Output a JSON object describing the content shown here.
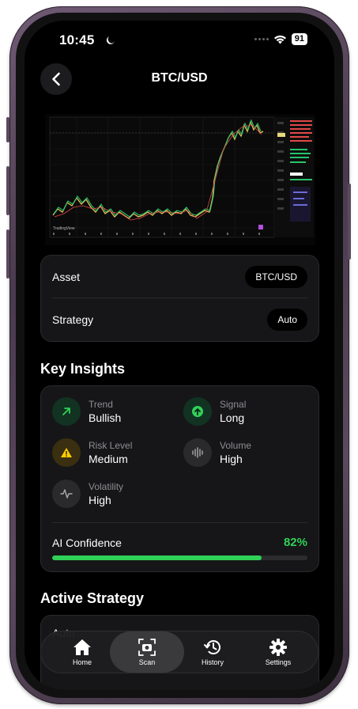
{
  "status_bar": {
    "time": "10:45",
    "battery": "91"
  },
  "header": {
    "title": "BTC/USD"
  },
  "chart_screenshot": {
    "watermark": "TradingView"
  },
  "info": {
    "asset_label": "Asset",
    "asset_value": "BTC/USD",
    "strategy_label": "Strategy",
    "strategy_value": "Auto"
  },
  "insights": {
    "title": "Key Insights",
    "items": [
      {
        "label": "Trend",
        "value": "Bullish",
        "icon": "trend-up-icon"
      },
      {
        "label": "Signal",
        "value": "Long",
        "icon": "arrow-up-circle-icon"
      },
      {
        "label": "Risk Level",
        "value": "Medium",
        "icon": "warning-icon"
      },
      {
        "label": "Volume",
        "value": "High",
        "icon": "waveform-icon"
      },
      {
        "label": "Volatility",
        "value": "High",
        "icon": "pulse-icon"
      }
    ],
    "confidence_label": "AI Confidence",
    "confidence_value": "82%",
    "confidence_fraction": 0.82
  },
  "active_strategy": {
    "title": "Active Strategy",
    "partial_text": "Auto"
  },
  "tabs": [
    {
      "label": "Home",
      "icon": "home-icon"
    },
    {
      "label": "Scan",
      "icon": "camera-icon",
      "active": true
    },
    {
      "label": "History",
      "icon": "history-icon"
    },
    {
      "label": "Settings",
      "icon": "gear-icon"
    }
  ],
  "colors": {
    "accent_green": "#30d158",
    "warning_yellow": "#ffcc00",
    "card": "#161618"
  }
}
